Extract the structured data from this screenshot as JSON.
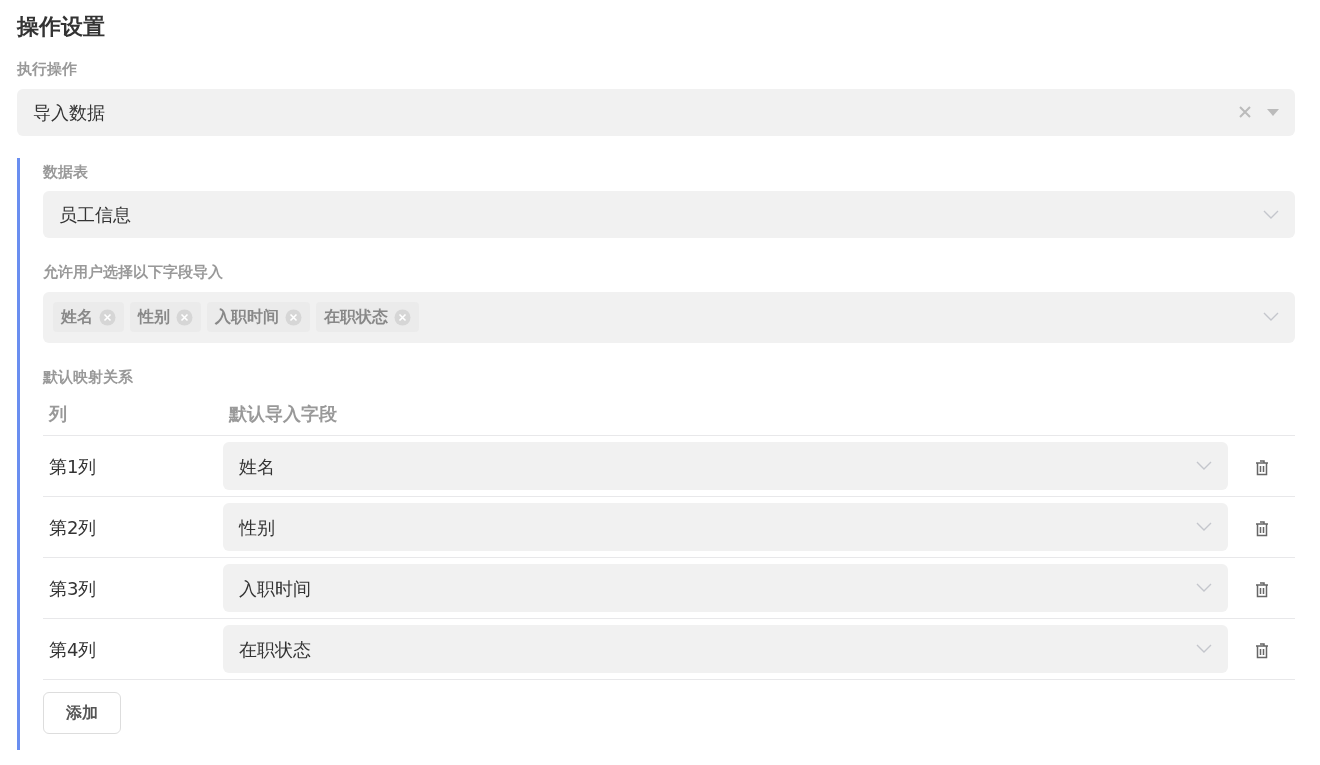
{
  "title": "操作设置",
  "action": {
    "label": "执行操作",
    "value": "导入数据",
    "clearable": true
  },
  "table_select": {
    "label": "数据表",
    "value": "员工信息"
  },
  "fields": {
    "label": "允许用户选择以下字段导入",
    "tags": [
      {
        "text": "姓名"
      },
      {
        "text": "性别"
      },
      {
        "text": "入职时间"
      },
      {
        "text": "在职状态"
      }
    ]
  },
  "mapping": {
    "label": "默认映射关系",
    "columns": [
      "列",
      "默认导入字段"
    ],
    "rows": [
      {
        "column": "第1列",
        "field": "姓名"
      },
      {
        "column": "第2列",
        "field": "性别"
      },
      {
        "column": "第3列",
        "field": "入职时间"
      },
      {
        "column": "第4列",
        "field": "在职状态"
      }
    ]
  },
  "add_button": "添加"
}
